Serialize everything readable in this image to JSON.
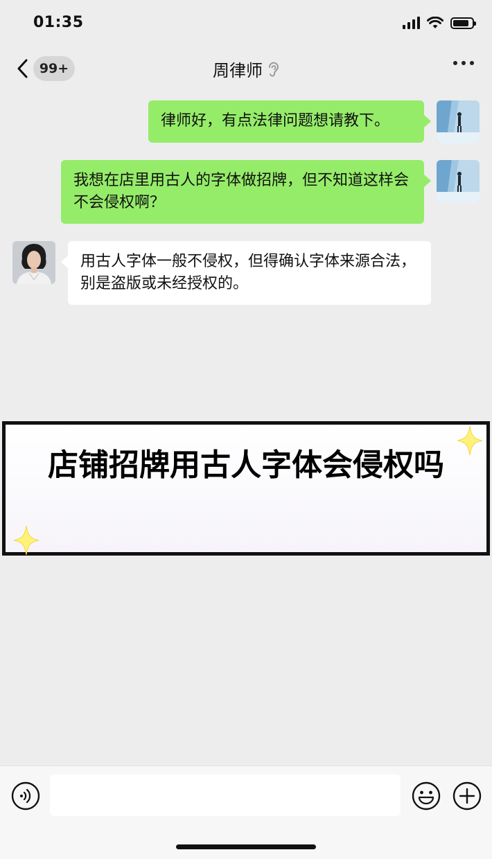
{
  "status_bar": {
    "time": "01:35",
    "battery_level": 0.85
  },
  "nav": {
    "badge": "99+",
    "title": "周律师",
    "icons": [
      "back-arrow-icon",
      "ear-icon",
      "more-icon"
    ]
  },
  "messages": [
    {
      "sender": "me",
      "text": "律师好，有点法律问题想请教下。"
    },
    {
      "sender": "me",
      "text": "我想在店里用古人的字体做招牌，但不知道这样会不会侵权啊？"
    },
    {
      "sender": "lawyer",
      "text": "用古人字体一般不侵权，但得确认字体来源合法，别是盗版或未经授权的。"
    }
  ],
  "title_card": {
    "text": "店铺招牌用古人字体会侵权吗"
  },
  "input_bar": {
    "placeholder": "",
    "icons": [
      "voice-icon",
      "emoji-icon",
      "plus-icon"
    ]
  },
  "colors": {
    "background": "#ededed",
    "my_bubble": "#95ec69",
    "other_bubble": "#ffffff",
    "sparkle": "#fff27a"
  }
}
